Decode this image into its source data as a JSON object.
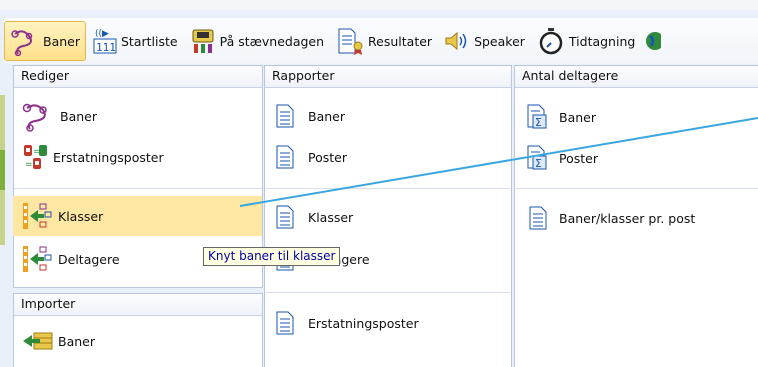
{
  "toolbar": {
    "items": [
      {
        "label": "Baner",
        "icon": "course-route-icon",
        "active": true
      },
      {
        "label": "Startliste",
        "icon": "start-list-icon"
      },
      {
        "label": "På stævnedagen",
        "icon": "event-day-icon"
      },
      {
        "label": "Resultater",
        "icon": "results-icon"
      },
      {
        "label": "Speaker",
        "icon": "speaker-icon"
      },
      {
        "label": "Tidtagning",
        "icon": "stopwatch-icon"
      }
    ]
  },
  "rediger": {
    "title": "Rediger",
    "items": [
      {
        "label": "Baner",
        "icon": "course-route-icon"
      },
      {
        "label": "Erstatningsposter",
        "icon": "replacement-controls-icon"
      },
      {
        "label": "Klasser",
        "icon": "classes-icon",
        "selected": true
      },
      {
        "label": "Deltagere",
        "icon": "participants-icon"
      }
    ]
  },
  "importer": {
    "title": "Importer",
    "items": [
      {
        "label": "Baner",
        "icon": "import-icon"
      }
    ]
  },
  "rapporter": {
    "title": "Rapporter",
    "items": [
      {
        "label": "Baner",
        "icon": "document-icon"
      },
      {
        "label": "Poster",
        "icon": "document-icon"
      },
      {
        "label": "Klasser",
        "icon": "document-icon"
      },
      {
        "label": "Deltagere",
        "icon": "document-icon"
      },
      {
        "label": "Erstatningsposter",
        "icon": "document-icon"
      }
    ]
  },
  "antal": {
    "title": "Antal deltagere",
    "items": [
      {
        "label": "Baner",
        "icon": "sum-document-icon"
      },
      {
        "label": "Poster",
        "icon": "sum-document-icon"
      },
      {
        "label": "Baner/klasser pr. post",
        "icon": "document-icon"
      }
    ]
  },
  "tooltip": {
    "text": "Knyt baner til klasser"
  },
  "colors": {
    "accent_line": "#3aa6e0",
    "selection": "#fde7a3",
    "panel_border": "#b9c7de"
  }
}
